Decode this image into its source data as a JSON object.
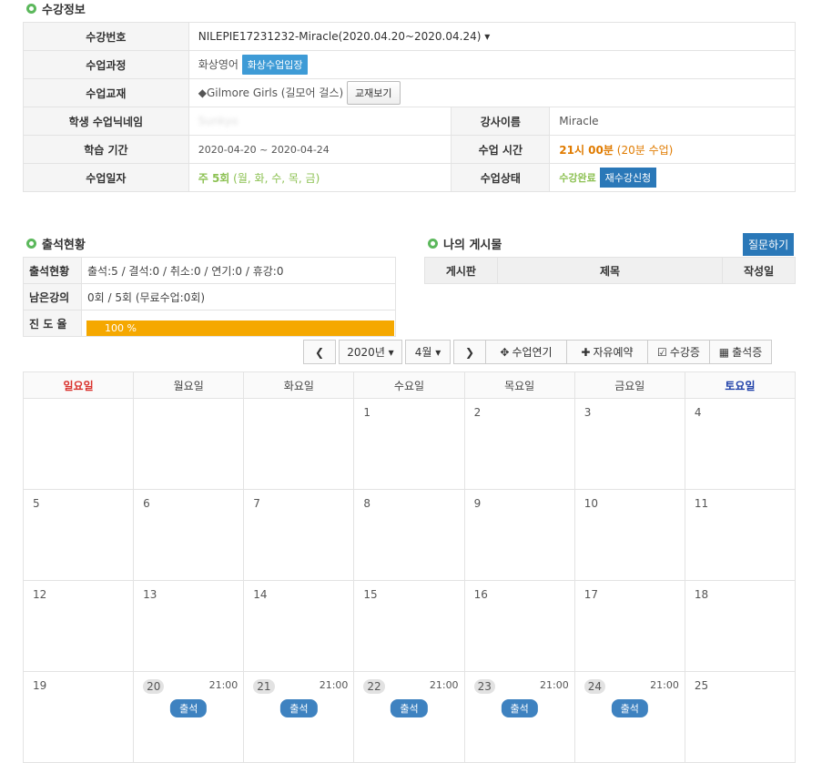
{
  "sections": {
    "enroll_title": "수강정보",
    "attend_title": "출석현황",
    "posts_title": "나의 게시물"
  },
  "info": {
    "enroll_no_label": "수강번호",
    "enroll_no_value": "NILEPIE17231232-Miracle(2020.04.20~2020.04.24) ▾",
    "course_label": "수업과정",
    "course_value": "화상영어",
    "course_btn": "화상수업입장",
    "book_label": "수업교재",
    "book_value": "◆Gilmore Girls (길모어 걸스)",
    "book_btn": "교재보기",
    "nickname_label": "학생 수업닉네임",
    "nickname_value": "Sunkyo",
    "teacher_label": "강사이름",
    "teacher_value": "Miracle",
    "period_label": "학습 기간",
    "period_value": "2020-04-20 ~ 2020-04-24",
    "time_label": "수업 시간",
    "time_value": "21시 00분",
    "time_extra": "(20분 수업)",
    "days_label": "수업일자",
    "days_value": "주 5회",
    "days_extra": "(월, 화, 수, 목, 금)",
    "status_label": "수업상태",
    "status_value": "수강완료",
    "status_btn": "재수강신청"
  },
  "attend": {
    "row1_label": "출석현황",
    "row1_value": "출석:5 / 결석:0 / 취소:0 / 연기:0 / 휴강:0",
    "row2_label": "남은강의",
    "row2_value": "0회 / 5회 (무료수업:0회)",
    "row3_label": "진 도 율",
    "progress_text": "100 %",
    "progress_fraction": 1.0
  },
  "posts": {
    "ask_btn": "질문하기",
    "col_board": "게시판",
    "col_title": "제목",
    "col_date": "작성일"
  },
  "toolbar": {
    "year": "2020년 ▾",
    "month": "4월 ▾",
    "postpone": "수업연기",
    "free_reserve": "자유예약",
    "certificate": "수강증",
    "attendance_cert": "출석증"
  },
  "calendar": {
    "days": [
      "일요일",
      "월요일",
      "화요일",
      "수요일",
      "목요일",
      "금요일",
      "토요일"
    ],
    "weeks": [
      [
        "",
        "",
        "",
        "1",
        "2",
        "3",
        "4"
      ],
      [
        "5",
        "6",
        "7",
        "8",
        "9",
        "10",
        "11"
      ],
      [
        "12",
        "13",
        "14",
        "15",
        "16",
        "17",
        "18"
      ],
      [
        "19",
        "20",
        "21",
        "22",
        "23",
        "24",
        "25"
      ]
    ],
    "class_time": "21:00",
    "attend_label": "출석",
    "colors": {
      "sunday": "#d9302b",
      "saturday": "#1d3fa8"
    }
  }
}
